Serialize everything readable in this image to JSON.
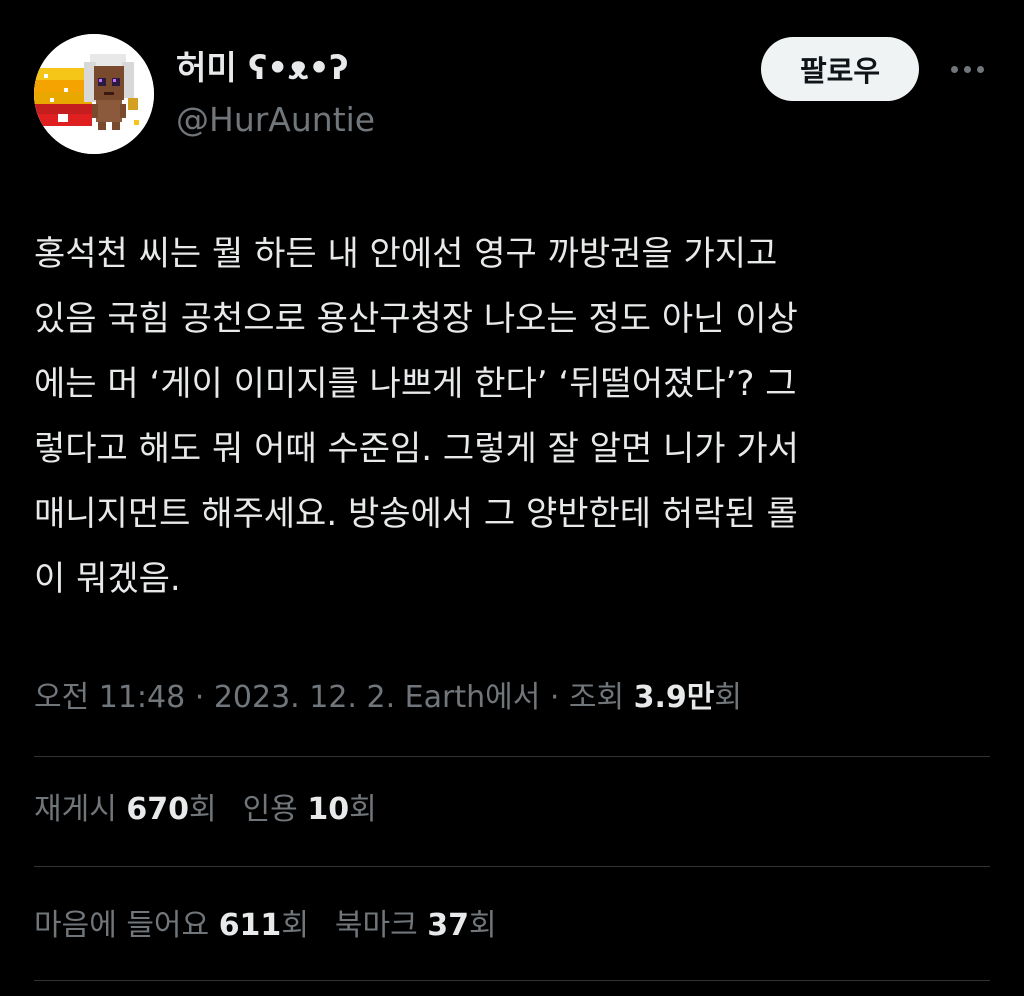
{
  "author": {
    "display_name": "허미 ʕ•ᴥ•ʔ",
    "handle": "@HurAuntie",
    "avatar_icon": "pixel-art-character-avatar"
  },
  "actions": {
    "follow_label": "팔로우",
    "more_icon": "more-horizontal-icon"
  },
  "tweet": {
    "lines": [
      "홍석천 씨는 뭘 하든 내 안에선 영구 까방권을 가지고",
      "있음 국힘 공천으로 용산구청장 나오는 정도 아닌 이상",
      "에는 머 ‘게이 이미지를 나쁘게 한다’ ‘뒤떨어졌다’? 그",
      "렇다고 해도 뭐 어때 수준임. 그렇게 잘 알면 니가 가서",
      "매니지먼트 해주세요. 방송에서 그 양반한테 허락된 롤",
      "이 뭐겠음."
    ]
  },
  "meta": {
    "time": "오전 11:48",
    "sep1": " · ",
    "date": "2023. 12. 2.",
    "source": " Earth에서",
    "sep2": " · ",
    "views_label": "조회 ",
    "views_value": "3.9만",
    "views_suffix": "회"
  },
  "stats": {
    "retweets": {
      "label": "재게시 ",
      "value": "670",
      "suffix": "회"
    },
    "quotes": {
      "label": "인용 ",
      "value": "10",
      "suffix": "회"
    },
    "likes": {
      "label": "마음에 들어요 ",
      "value": "611",
      "suffix": "회"
    },
    "bookmarks": {
      "label": "북마크 ",
      "value": "37",
      "suffix": "회"
    }
  },
  "colors": {
    "background": "#000000",
    "primary_text": "#e7e9ea",
    "secondary_text": "#71767b",
    "divider": "#2f3336",
    "follow_button_bg": "#eff3f4"
  }
}
